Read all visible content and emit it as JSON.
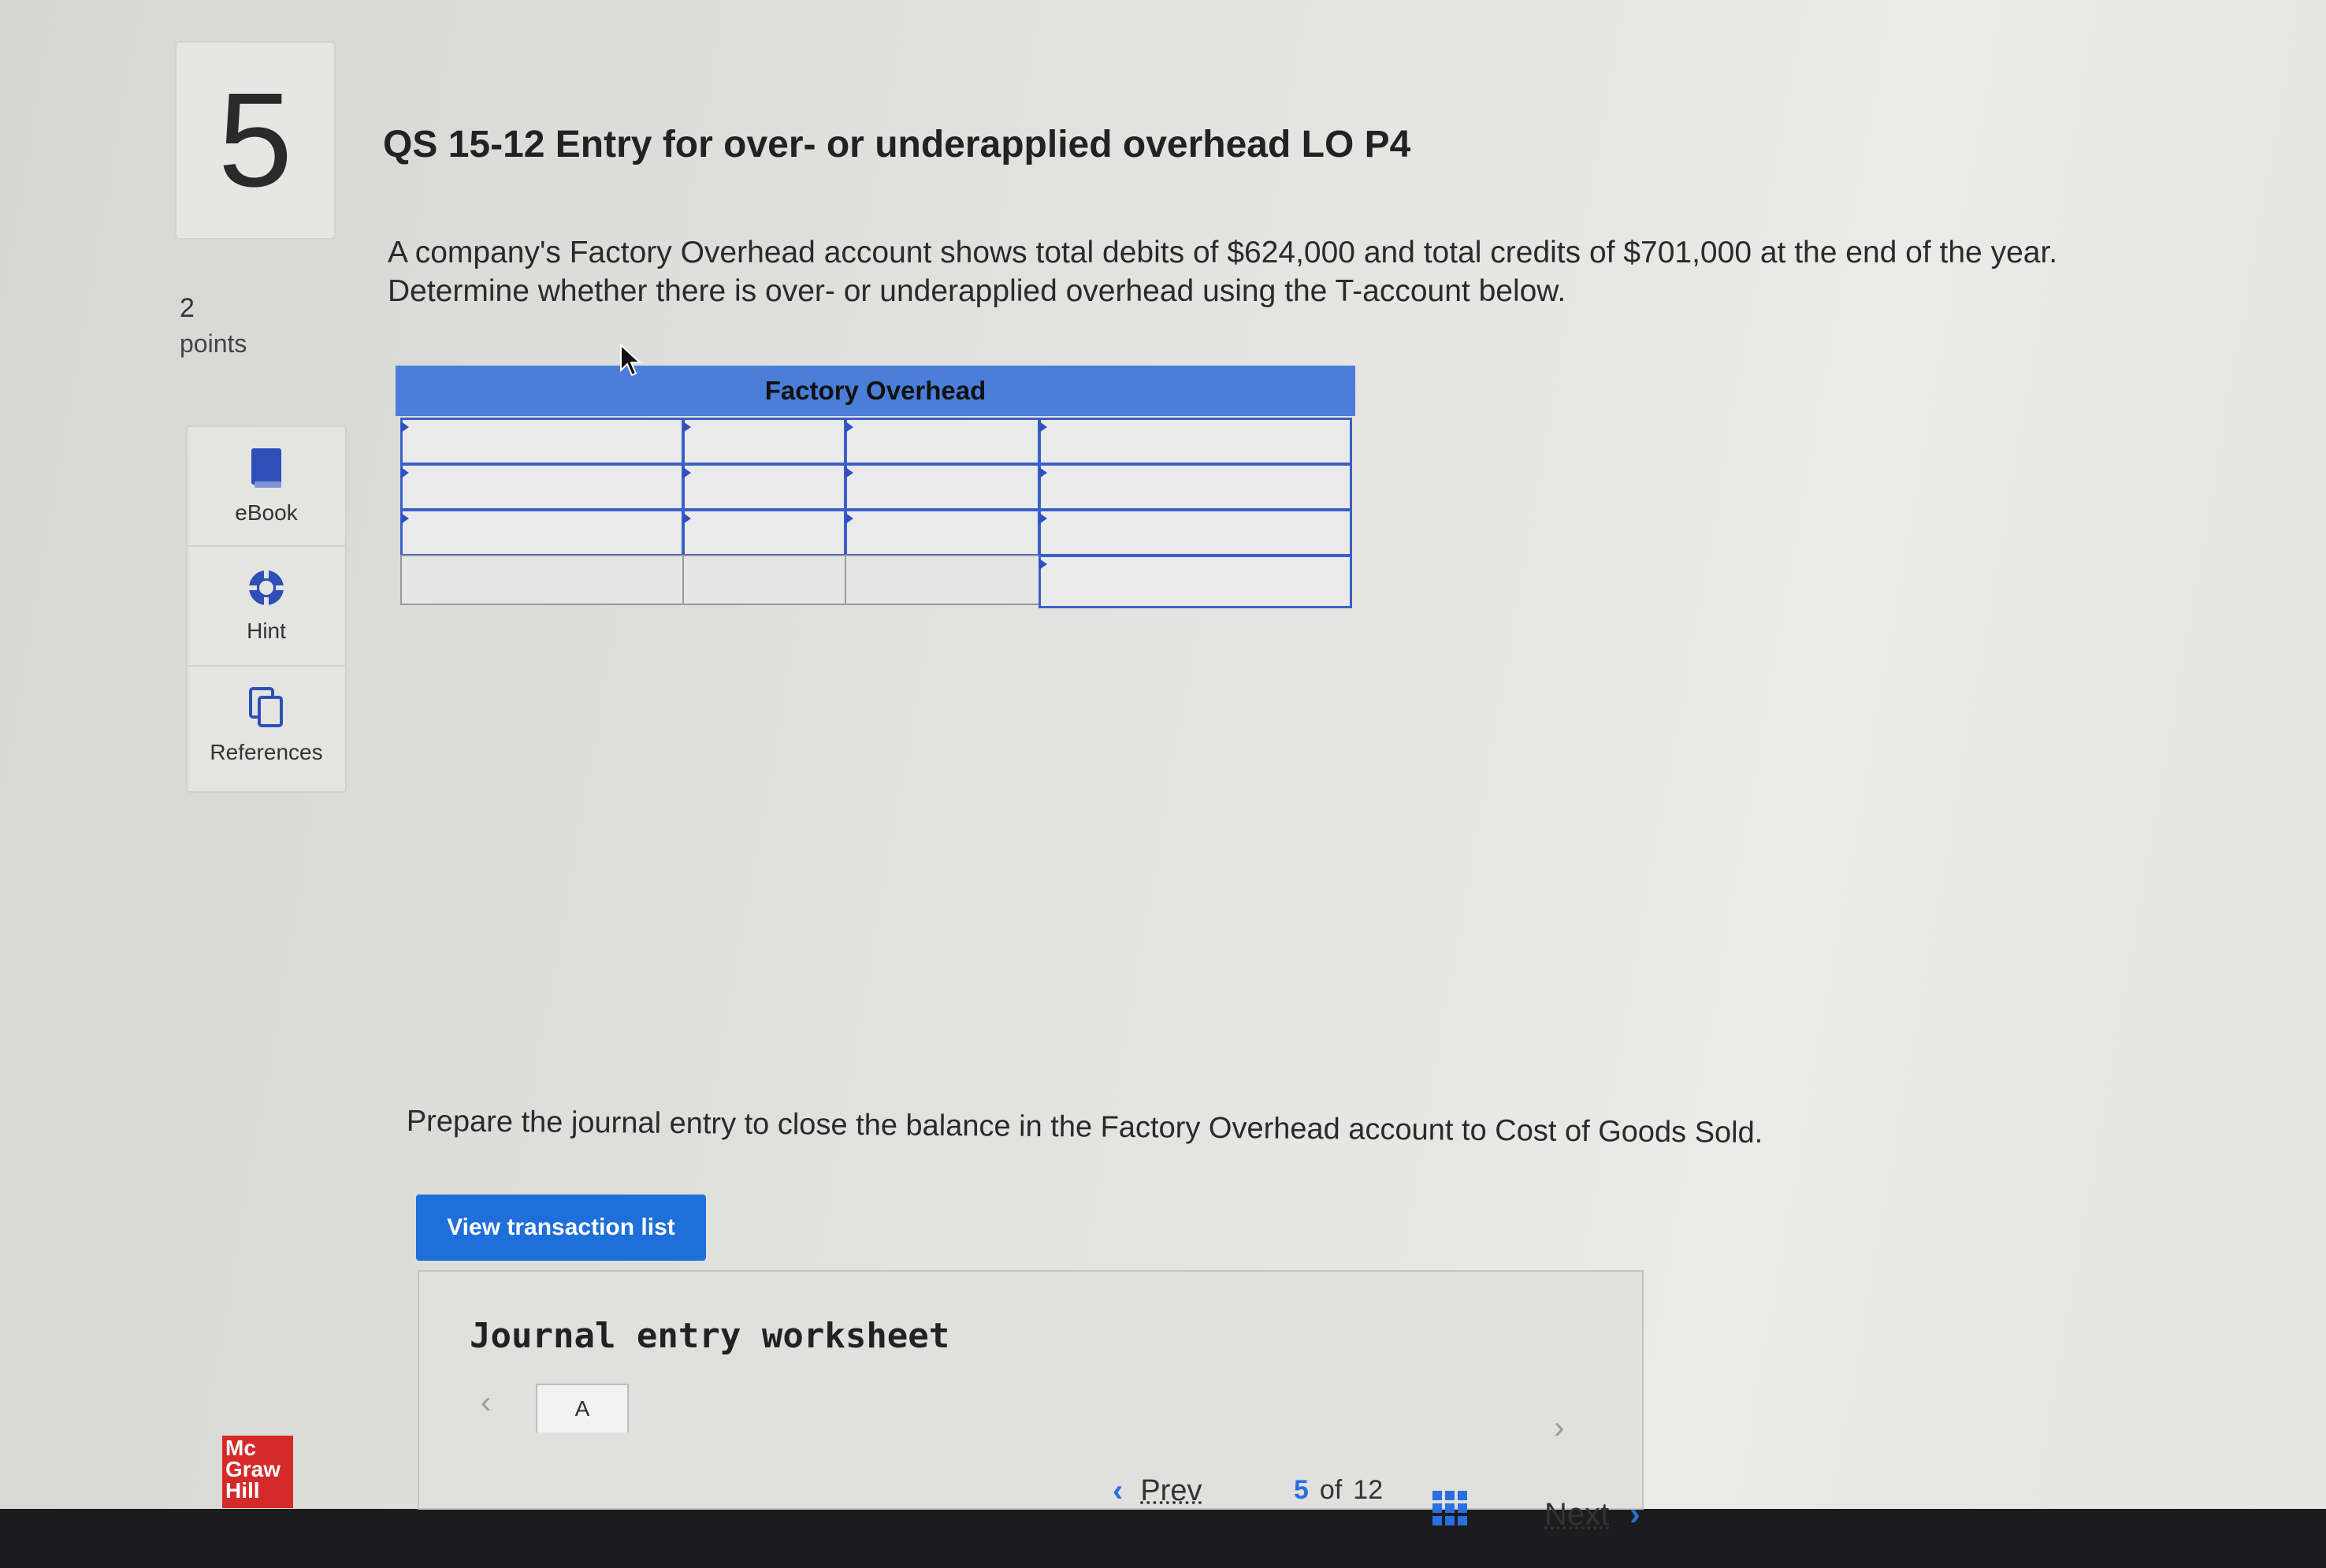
{
  "question": {
    "number": "5",
    "points_value": "2",
    "points_label": "points",
    "title": "QS 15-12 Entry for over- or underapplied overhead LO P4",
    "description": "A company's Factory Overhead account shows total debits of $624,000 and total credits of $701,000 at the end of the year. Determine whether there is over- or underapplied overhead using the T-account below.",
    "prompt": "Prepare the journal entry to close the balance in the Factory Overhead account to Cost of Goods Sold."
  },
  "tools": [
    {
      "label": "eBook",
      "icon": "book-icon"
    },
    {
      "label": "Hint",
      "icon": "lifebuoy-icon"
    },
    {
      "label": "References",
      "icon": "copy-icon"
    }
  ],
  "t_account": {
    "title": "Factory Overhead",
    "rows": 4,
    "columns": 4
  },
  "buttons": {
    "view_transaction_list": "View transaction list"
  },
  "worksheet": {
    "title": "Journal entry worksheet",
    "tab_label": "A"
  },
  "logo": {
    "line1": "Mc",
    "line2": "Graw",
    "line3": "Hill"
  },
  "navigation": {
    "prev_label": "Prev",
    "current_page": "5",
    "of_label": "of",
    "total_pages": "12",
    "next_label": "Next"
  },
  "colors": {
    "accent": "#1e6fd9",
    "table_header": "#4a7ed8",
    "cell_border": "#3a5fc8",
    "logo_red": "#d42a2a"
  }
}
